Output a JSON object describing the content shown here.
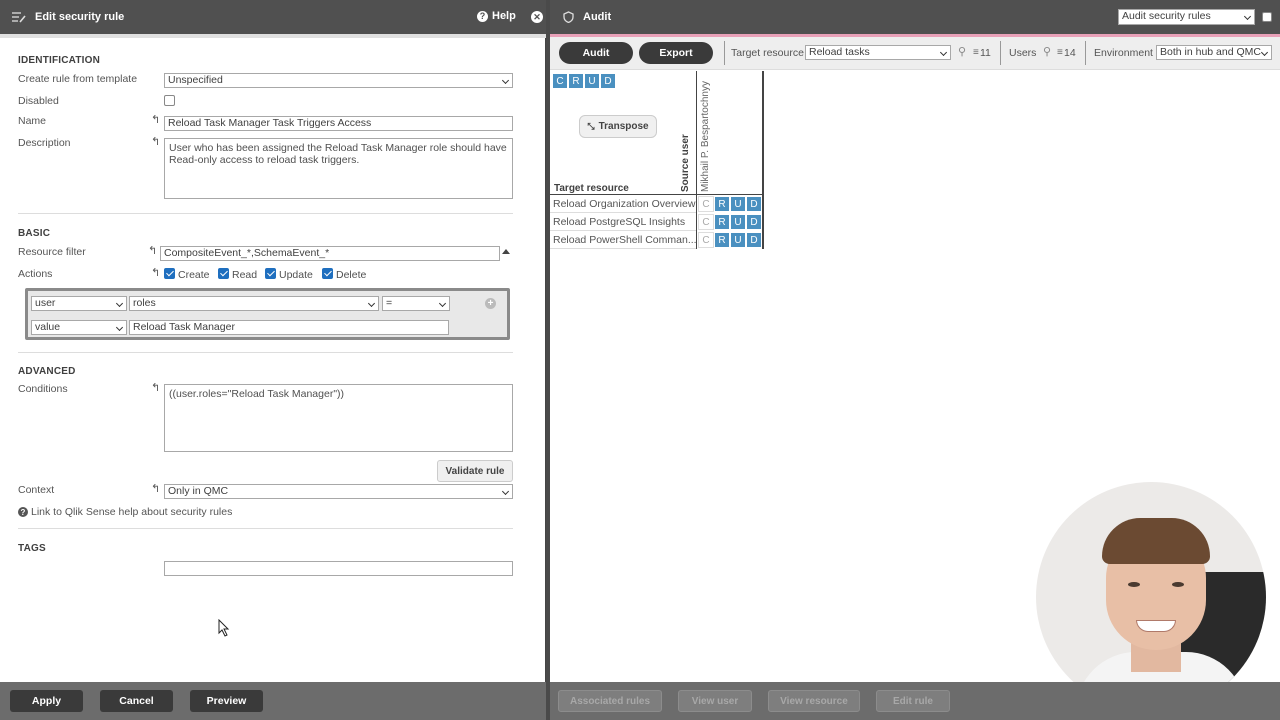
{
  "left": {
    "title": "Edit security rule",
    "help_label": "Help",
    "identification": {
      "heading": "IDENTIFICATION",
      "template_label": "Create rule from template",
      "template_value": "Unspecified",
      "disabled_label": "Disabled",
      "name_label": "Name",
      "name_value": "Reload Task Manager Task Triggers Access",
      "description_label": "Description",
      "description_value": "User who has been assigned the Reload Task Manager role should have Read-only access to reload task triggers."
    },
    "basic": {
      "heading": "BASIC",
      "resource_filter_label": "Resource filter",
      "resource_filter_value": "CompositeEvent_*,SchemaEvent_*",
      "actions_label": "Actions",
      "actions": [
        {
          "label": "Create",
          "checked": true
        },
        {
          "label": "Read",
          "checked": true
        },
        {
          "label": "Update",
          "checked": true
        },
        {
          "label": "Delete",
          "checked": true
        }
      ],
      "condition_row1": {
        "subject": "user",
        "attribute": "roles",
        "operator": "="
      },
      "condition_row2": {
        "type": "value",
        "value": "Reload Task Manager"
      }
    },
    "advanced": {
      "heading": "ADVANCED",
      "conditions_label": "Conditions",
      "conditions_value": "((user.roles=\"Reload Task Manager\"))",
      "validate_label": "Validate rule",
      "context_label": "Context",
      "context_value": "Only in QMC",
      "help_link": "Link to Qlik Sense help about security rules"
    },
    "tags": {
      "heading": "TAGS",
      "value": ""
    },
    "footer": {
      "apply": "Apply",
      "cancel": "Cancel",
      "preview": "Preview"
    }
  },
  "right": {
    "title": "Audit",
    "view_select": "Audit security rules",
    "audit_button": "Audit",
    "export_button": "Export",
    "target_resource_label": "Target resource",
    "target_resource_value": "Reload tasks",
    "target_count": "11",
    "users_label": "Users",
    "users_count": "14",
    "environment_label": "Environment",
    "environment_value": "Both in hub and QMC",
    "crud_header": [
      "C",
      "R",
      "U",
      "D"
    ],
    "transpose_label": "Transpose",
    "source_user_label": "Source user",
    "user_name": "Mikhail P. Bespartochnyy",
    "target_resource_col": "Target resource",
    "rows": [
      {
        "name": "Reload Organization Overview",
        "crud": [
          "C",
          "R",
          "U",
          "D"
        ]
      },
      {
        "name": "Reload PostgreSQL Insights",
        "crud": [
          "C",
          "R",
          "U",
          "D"
        ]
      },
      {
        "name": "Reload PowerShell Comman...",
        "crud": [
          "C",
          "R",
          "U",
          "D"
        ]
      }
    ],
    "footer": {
      "associated_rules": "Associated rules",
      "view_user": "View user",
      "view_resource": "View resource",
      "edit_rule": "Edit rule"
    }
  },
  "colors": {
    "accent": "#4a90c0",
    "topbar": "#505050",
    "divider": "#e8a0b8"
  }
}
